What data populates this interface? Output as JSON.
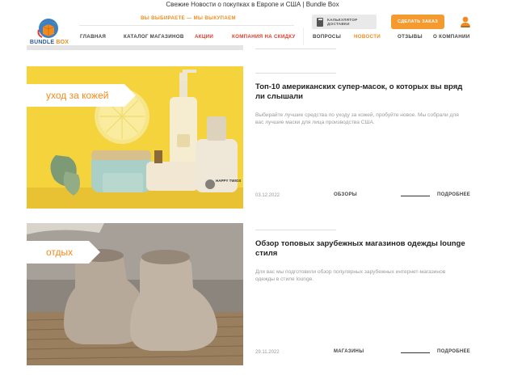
{
  "window": {
    "title": "Свежие Новости о покупках в Европе и США | Bundle Box"
  },
  "header": {
    "logo": {
      "word1": "BUNDLE",
      "word2": "BOX"
    },
    "slogan": "ВЫ ВЫБИРАЕТЕ — МЫ ВЫКУПАЕМ",
    "calc_button": {
      "line1": "КАЛЬКУЛЯТОР",
      "line2": "ДОСТАВКИ"
    },
    "order_button": "СДЕЛАТЬ ЗАКАЗ",
    "nav": [
      {
        "label": "ГЛАВНАЯ"
      },
      {
        "label": "КАТАЛОГ МАГАЗИНОВ"
      },
      {
        "label": "АКЦИИ"
      },
      {
        "label": "КОМПАНИЯ НА СКИДКУ"
      },
      {
        "label": "ВОПРОСЫ"
      },
      {
        "label": "НОВОСТИ"
      },
      {
        "label": "ОТЗЫВЫ"
      },
      {
        "label": "О КОМПАНИИ"
      }
    ]
  },
  "articles": [
    {
      "tag": "уход за кожей",
      "title": "Топ-10 американских супер-масок, о которых вы вряд ли слышали",
      "description": "Выбирайте лучшие средства по уходу за кожей, пробуйте новое. Мы собрали для вас лучшие маски для лица производства США.",
      "date": "03.12.2022",
      "category": "ОБЗОРЫ",
      "more": "ПОДРОБНЕЕ",
      "bottle_brand": "HAPPY TWIGS"
    },
    {
      "tag": "отдых",
      "title": "Обзор топовых зарубежных магазинов одежды lounge стиля",
      "description": "Для вас мы подготовили обзор популярных зарубежных интернет-магазинов одежды в стиле lounge.",
      "date": "29.11.2022",
      "category": "МАГАЗИНЫ",
      "more": "ПОДРОБНЕЕ"
    }
  ],
  "colors": {
    "accent": "#f28b1e",
    "highlight": "#e03a2c",
    "order_button": "#f59a2f",
    "skincare_bg": "#f4d33c"
  }
}
